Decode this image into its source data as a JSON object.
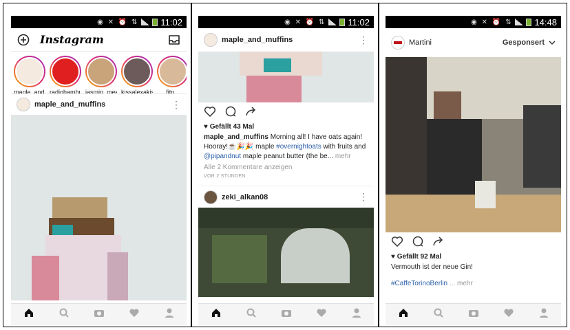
{
  "screen1": {
    "status_time": "11:02",
    "app_title": "Instagram",
    "stories": [
      {
        "name": "maple_and_..."
      },
      {
        "name": "radiohamburg"
      },
      {
        "name": "jasmin_meere"
      },
      {
        "name": "kissalexakiss"
      },
      {
        "name": "fitn..."
      }
    ],
    "post_user": "maple_and_muffins"
  },
  "screen2": {
    "status_time": "11:02",
    "post_user": "maple_and_muffins",
    "likes": "Gefällt 43 Mal",
    "caption_user": "maple_and_muffins",
    "caption_text1": " Morning all! I have oats again! Hooray!",
    "caption_emoji": "☕🎉🎉",
    "caption_text2": " maple ",
    "hashtag": "#overnightoats",
    "caption_text3": " with fruits and ",
    "mention": "@pipandnut",
    "caption_text4": " maple peanut butter (the be...",
    "more": " mehr",
    "comments_link": "Alle 2 Kommentare anzeigen",
    "timestamp": "VOR 2 STUNDEN",
    "post2_user": "zeki_alkan08"
  },
  "screen3": {
    "status_time": "14:48",
    "post_user": "Martini",
    "sponsored": "Gesponsert",
    "likes": "Gefällt 92 Mal",
    "caption": "Vermouth ist der neue Gin!",
    "hashtag": "#CaffeTorinoBerlin",
    "more": " ... mehr"
  },
  "icons": [
    "camera-plus-icon",
    "inbox-icon",
    "more-options-icon",
    "heart-icon",
    "comment-icon",
    "share-icon",
    "home-icon",
    "search-icon",
    "camera-icon",
    "profile-icon",
    "chevron-down-icon"
  ],
  "colors": {
    "link": "#2b5ea8",
    "battery": "#7ab32e",
    "story_ring": "#e1306c"
  }
}
